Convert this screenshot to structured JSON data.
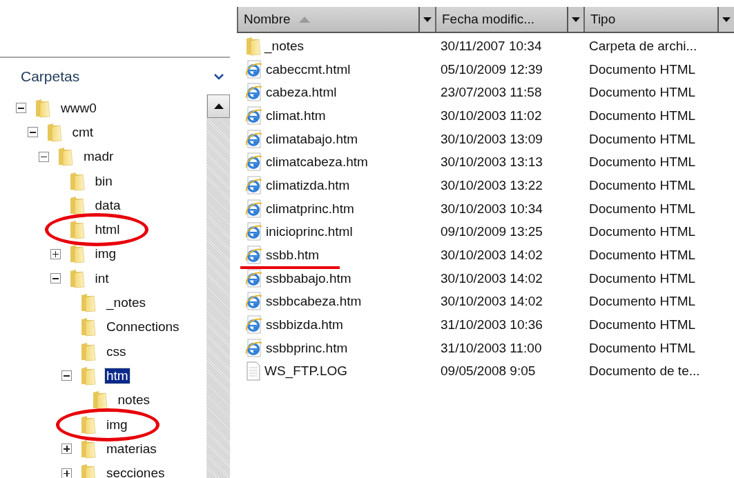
{
  "folders_pane": {
    "title": "Carpetas",
    "tree": [
      {
        "name": "www0",
        "expanded": true,
        "selected": false,
        "circled": false,
        "children": [
          {
            "name": "cmt",
            "expanded": true,
            "selected": false,
            "circled": false,
            "children": [
              {
                "name": "madr",
                "expanded": true,
                "selected": false,
                "circled": false,
                "children": [
                  {
                    "name": "bin",
                    "selected": false,
                    "circled": false
                  },
                  {
                    "name": "data",
                    "selected": false,
                    "circled": false
                  },
                  {
                    "name": "html",
                    "selected": false,
                    "circled": true
                  },
                  {
                    "name": "img",
                    "expanded": false,
                    "selected": false,
                    "circled": false
                  },
                  {
                    "name": "int",
                    "expanded": true,
                    "selected": false,
                    "circled": false,
                    "children": [
                      {
                        "name": "_notes",
                        "selected": false,
                        "circled": false
                      },
                      {
                        "name": "Connections",
                        "selected": false,
                        "circled": false
                      },
                      {
                        "name": "css",
                        "selected": false,
                        "circled": false
                      },
                      {
                        "name": "htm",
                        "expanded": true,
                        "selected": true,
                        "circled": false,
                        "children": [
                          {
                            "name": "notes",
                            "selected": false,
                            "circled": false
                          }
                        ]
                      },
                      {
                        "name": "img",
                        "selected": false,
                        "circled": true
                      },
                      {
                        "name": "materias",
                        "expanded": false,
                        "selected": false,
                        "circled": false
                      },
                      {
                        "name": "secciones",
                        "expanded": false,
                        "selected": false,
                        "circled": false
                      }
                    ]
                  }
                ]
              }
            ]
          }
        ]
      }
    ]
  },
  "file_list": {
    "columns": [
      "Nombre",
      "Fecha modific...",
      "Tipo"
    ],
    "rows": [
      {
        "kind": "folder",
        "name": "_notes",
        "date": "30/11/2007 10:34",
        "type": "Carpeta de archi...",
        "underlined": false
      },
      {
        "kind": "html",
        "name": "cabeccmt.html",
        "date": "05/10/2009 12:39",
        "type": "Documento HTML",
        "underlined": false
      },
      {
        "kind": "html",
        "name": "cabeza.html",
        "date": "23/07/2003 11:58",
        "type": "Documento HTML",
        "underlined": false
      },
      {
        "kind": "html",
        "name": "climat.htm",
        "date": "30/10/2003 11:02",
        "type": "Documento HTML",
        "underlined": false
      },
      {
        "kind": "html",
        "name": "climatabajo.htm",
        "date": "30/10/2003 13:09",
        "type": "Documento HTML",
        "underlined": false
      },
      {
        "kind": "html",
        "name": "climatcabeza.htm",
        "date": "30/10/2003 13:13",
        "type": "Documento HTML",
        "underlined": false
      },
      {
        "kind": "html",
        "name": "climatizda.htm",
        "date": "30/10/2003 13:22",
        "type": "Documento HTML",
        "underlined": false
      },
      {
        "kind": "html",
        "name": "climatprinc.htm",
        "date": "30/10/2003 10:34",
        "type": "Documento HTML",
        "underlined": false
      },
      {
        "kind": "html",
        "name": "inicioprinc.html",
        "date": "09/10/2009 13:25",
        "type": "Documento HTML",
        "underlined": false
      },
      {
        "kind": "html",
        "name": "ssbb.htm",
        "date": "30/10/2003 14:02",
        "type": "Documento HTML",
        "underlined": true
      },
      {
        "kind": "html",
        "name": "ssbbabajo.htm",
        "date": "30/10/2003 14:02",
        "type": "Documento HTML",
        "underlined": false
      },
      {
        "kind": "html",
        "name": "ssbbcabeza.htm",
        "date": "30/10/2003 14:02",
        "type": "Documento HTML",
        "underlined": false
      },
      {
        "kind": "html",
        "name": "ssbbizda.htm",
        "date": "31/10/2003 10:36",
        "type": "Documento HTML",
        "underlined": false
      },
      {
        "kind": "html",
        "name": "ssbbprinc.htm",
        "date": "31/10/2003 11:00",
        "type": "Documento HTML",
        "underlined": false
      },
      {
        "kind": "text",
        "name": "WS_FTP.LOG",
        "date": "09/05/2008 9:05",
        "type": "Documento de te...",
        "underlined": false
      }
    ]
  }
}
